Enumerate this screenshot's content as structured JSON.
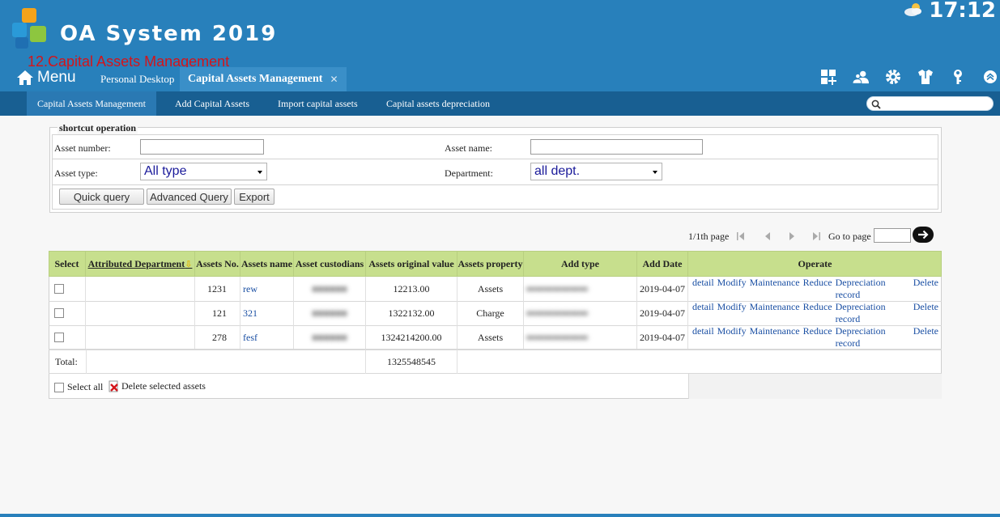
{
  "header": {
    "app_title": "OA System 2019",
    "module_caption": "12.Capital Assets Management",
    "clock": "17:12",
    "weather_icon": "partly-cloudy-icon",
    "menu_label": "Menu",
    "tabs": [
      {
        "label": "Personal Desktop",
        "active": false
      },
      {
        "label": "Capital Assets Management",
        "active": true,
        "closable": true
      }
    ],
    "close_glyph": "✕",
    "toolbar_icons": [
      "apps-grid-icon",
      "user-group-icon",
      "gear-icon",
      "shirt-icon",
      "key-icon",
      "chevron-up-icon"
    ]
  },
  "subnav": {
    "items": [
      {
        "label": "Capital Assets Management",
        "active": true
      },
      {
        "label": "Add Capital Assets",
        "active": false
      },
      {
        "label": "Import capital assets",
        "active": false
      },
      {
        "label": "Capital assets depreciation",
        "active": false
      }
    ],
    "search_placeholder": ""
  },
  "shortcut": {
    "legend": "shortcut operation",
    "asset_number_label": "Asset number:",
    "asset_number_value": "",
    "asset_name_label": "Asset name:",
    "asset_name_value": "",
    "asset_type_label": "Asset type:",
    "asset_type_value": "All type",
    "department_label": "Department:",
    "department_value": "all dept.",
    "buttons": {
      "quick": "Quick query",
      "advanced": "Advanced Query",
      "export": "Export"
    }
  },
  "pager": {
    "page_text": "1/1th page",
    "goto_label": "Go to page",
    "goto_value": ""
  },
  "table": {
    "columns": [
      "Select",
      "Attributed Department",
      "Assets No.",
      "Assets name",
      "Asset custodians",
      "Assets original value",
      "Assets property",
      "Add type",
      "Add Date",
      "Operate"
    ],
    "sort_glyph": "⇩",
    "rows": [
      {
        "department": "",
        "no": "1231",
        "name": "rew",
        "custodian": "■■■■■■",
        "value": "12213.00",
        "property": "Assets",
        "add_type": "■■■■■■■■■■■■■■",
        "date": "2019-04-07"
      },
      {
        "department": "",
        "no": "121",
        "name": "321",
        "custodian": "■■■■■■",
        "value": "1322132.00",
        "property": "Charge",
        "add_type": "■■■■■■■■■■■■■■",
        "date": "2019-04-07"
      },
      {
        "department": "",
        "no": "278",
        "name": "fesf",
        "custodian": "■■■■■■",
        "value": "1324214200.00",
        "property": "Assets",
        "add_type": "■■■■■■■■■■■■■■",
        "date": "2019-04-07"
      }
    ],
    "operations": [
      "detail",
      "Modify",
      "Maintenance",
      "Reduce",
      "Depreciation record",
      "Delete"
    ],
    "total_label": "Total:",
    "total_value": "1325548545",
    "select_all_label": "Select all",
    "delete_selected_label": "Delete selected assets"
  },
  "colors": {
    "header_bg": "#2880bb",
    "subnav_bg": "#185f92",
    "table_header_bg": "#c7df8d",
    "link": "#1a4fa3",
    "caption_red": "#d4141a"
  }
}
